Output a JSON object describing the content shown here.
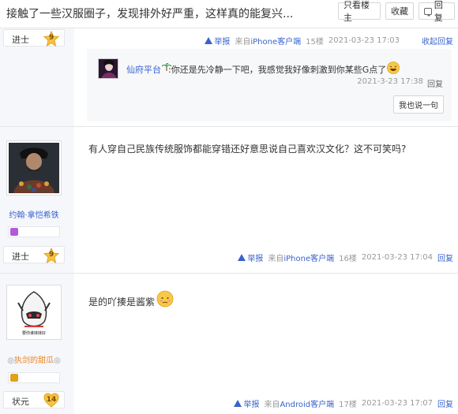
{
  "header": {
    "title": "接触了一些汉服圈子，发现排外好严重，这样真的能复兴...",
    "only_op": "只看楼主",
    "favorite": "收藏",
    "reply": "回复"
  },
  "posts": [
    {
      "rank": "进士",
      "level": "9",
      "meta": {
        "report": "举报",
        "source_prefix": "来自",
        "source": "iPhone客户端",
        "floor": "15楼",
        "date": "2021-03-23 17:03",
        "action": "收起回复"
      },
      "subreply": {
        "name": "仙府平台",
        "text": ":你还是先冷静一下吧，我感觉我好像刺激到你某些G点了",
        "date": "2021-3-23 17:38",
        "reply": "回复",
        "button": "我也说一句"
      }
    },
    {
      "username": "约翰·拿恺希铁",
      "rank": "进士",
      "level": "9",
      "content": "有人穿自己民族传统服饰都能穿错还好意思说自己喜欢汉文化？这不可笑吗?",
      "meta": {
        "report": "举报",
        "source_prefix": "来自",
        "source": "iPhone客户端",
        "floor": "16楼",
        "date": "2021-03-23 17:04",
        "action": "回复"
      }
    },
    {
      "username": "执剑的甜瓜",
      "avatar_text": "要你谁妹妹好",
      "rank": "状元",
      "level": "14",
      "content": "是的吖揍是酱紫",
      "meta": {
        "report": "举报",
        "source_prefix": "来自",
        "source": "Android客户端",
        "floor": "17楼",
        "date": "2021-03-23 17:07",
        "action": "回复"
      }
    }
  ],
  "colors": {
    "link": "#3863ce",
    "left_bg": "#f6f7fb",
    "sub_bg": "#f7f8fa"
  }
}
